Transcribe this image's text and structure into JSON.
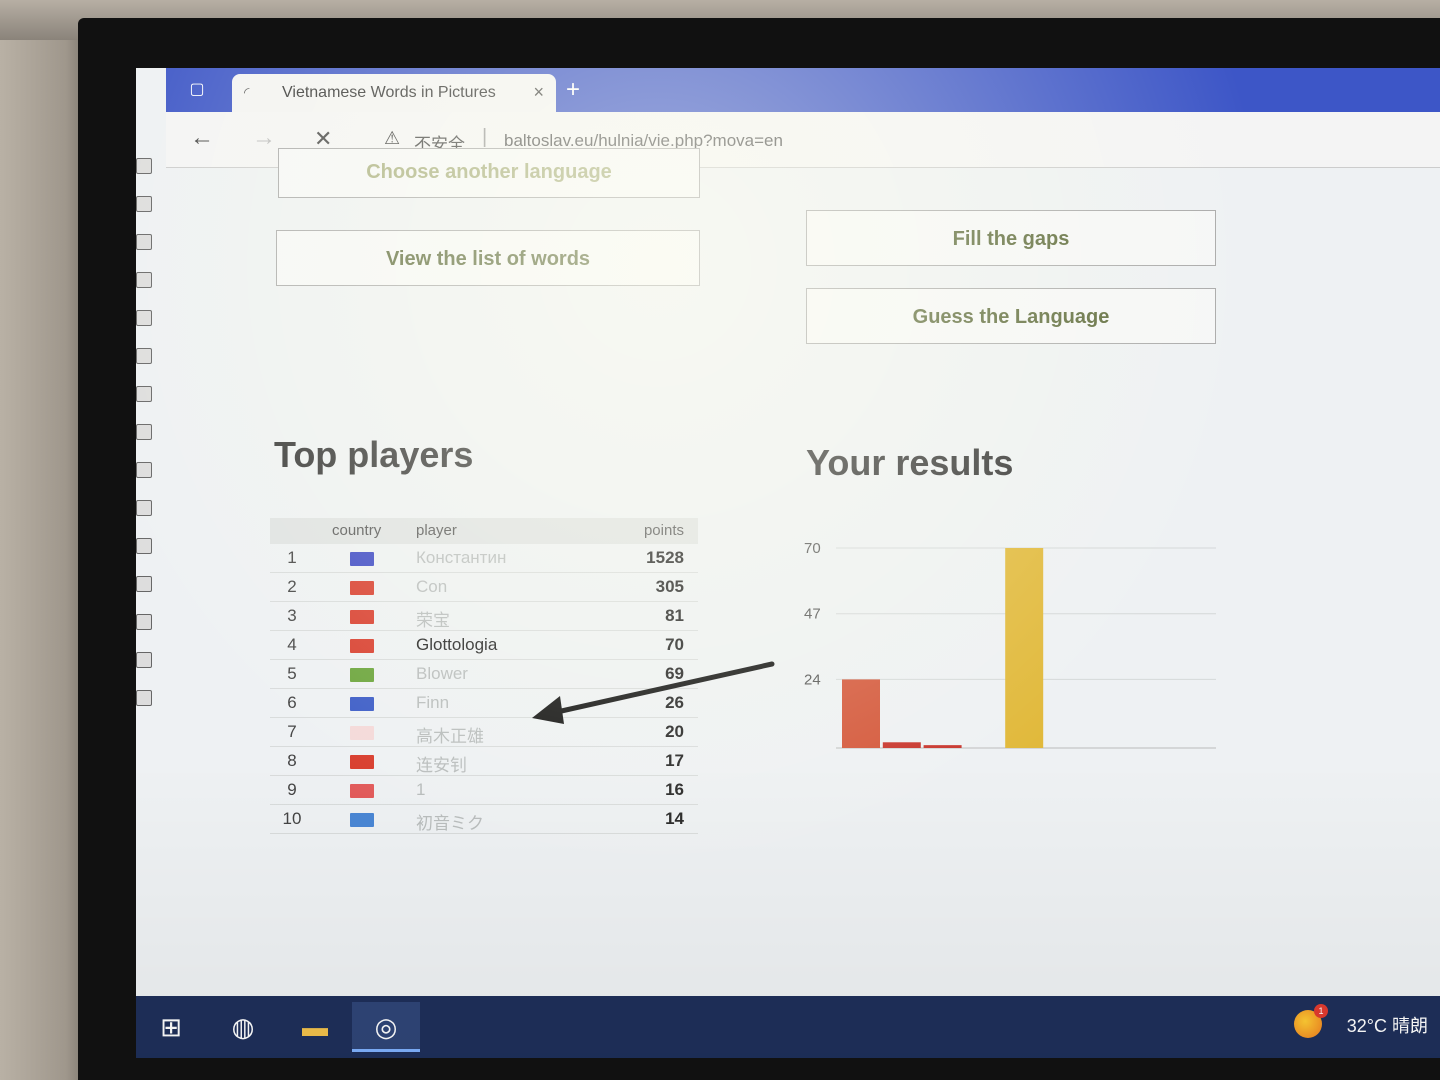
{
  "browser": {
    "tab_title": "Vietnamese Words in Pictures",
    "tab_close": "×",
    "new_tab": "+",
    "security_label": "不安全",
    "url": "baltoslav.eu/hulnia/vie.php?mova=en"
  },
  "buttons": {
    "choose_language": "Choose another language",
    "view_list": "View the list of words",
    "fill_gaps": "Fill the gaps",
    "guess_language": "Guess the Language"
  },
  "top_players": {
    "heading": "Top players",
    "columns": {
      "country": "country",
      "player": "player",
      "points": "points"
    },
    "rows": [
      {
        "rank": "1",
        "flag_color": "#3b47c4",
        "player": "Константин",
        "points": "1528"
      },
      {
        "rank": "2",
        "flag_color": "#d83c2c",
        "player": "Con",
        "points": "305"
      },
      {
        "rank": "3",
        "flag_color": "#d83c2c",
        "player": "荣宝",
        "points": "81"
      },
      {
        "rank": "4",
        "flag_color": "#d83c2c",
        "player": "Glottologia",
        "points": "70"
      },
      {
        "rank": "5",
        "flag_color": "#6aa43a",
        "player": "Blower",
        "points": "69"
      },
      {
        "rank": "6",
        "flag_color": "#3a5bc7",
        "player": "Finn",
        "points": "26"
      },
      {
        "rank": "7",
        "flag_color": "#f4d9d9",
        "player": "高木正雄",
        "points": "20"
      },
      {
        "rank": "8",
        "flag_color": "#d83c2c",
        "player": "连安钊",
        "points": "17"
      },
      {
        "rank": "9",
        "flag_color": "#e25a5a",
        "player": "1",
        "points": "16"
      },
      {
        "rank": "10",
        "flag_color": "#4a86d4",
        "player": "初音ミク",
        "points": "14"
      }
    ]
  },
  "results": {
    "heading": "Your results"
  },
  "chart_data": {
    "type": "bar",
    "categories": [
      "",
      "",
      "",
      "",
      ""
    ],
    "values": [
      24,
      2,
      1,
      0,
      70
    ],
    "colors": [
      "#d4573a",
      "#c8352c",
      "#c8352c",
      "#cccccc",
      "#e1b93b"
    ],
    "yticks": [
      24,
      47,
      70
    ],
    "ylim": [
      0,
      70
    ],
    "title": "",
    "xlabel": "",
    "ylabel": ""
  },
  "taskbar": {
    "weather_badge": "1",
    "weather": "32°C 晴朗"
  }
}
